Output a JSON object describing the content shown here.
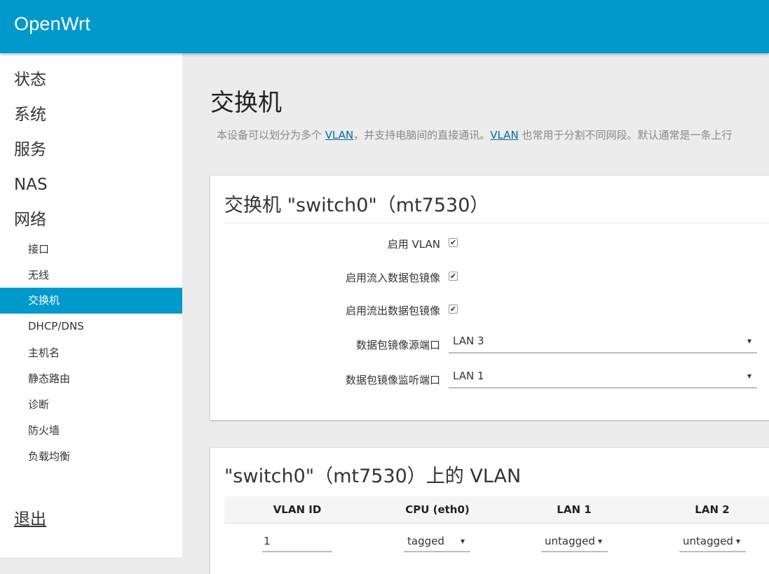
{
  "app": {
    "brand": "OpenWrt"
  },
  "sidebar": {
    "top_items": [
      {
        "label": "状态"
      },
      {
        "label": "系统"
      },
      {
        "label": "服务"
      },
      {
        "label": "NAS"
      },
      {
        "label": "网络"
      }
    ],
    "network_items": [
      {
        "label": "接口"
      },
      {
        "label": "无线"
      },
      {
        "label": "交换机"
      },
      {
        "label": "DHCP/DNS"
      },
      {
        "label": "主机名"
      },
      {
        "label": "静态路由"
      },
      {
        "label": "诊断"
      },
      {
        "label": "防火墙"
      },
      {
        "label": "负载均衡"
      }
    ],
    "active_item": "交换机",
    "logout": "退出"
  },
  "page": {
    "title": "交换机",
    "desc_1": "本设备可以划分为多个 ",
    "desc_link_1": "VLAN",
    "desc_2": "，并支持电脑间的直接通讯。",
    "desc_link_2": "VLAN",
    "desc_3": " 也常用于分割不同网段。默认通常是一条上行"
  },
  "switch_section": {
    "title": "交换机 \"switch0\"（mt7530）",
    "enable_vlan_label": "启用 VLAN",
    "enable_vlan_checked": true,
    "mirror_rx_label": "启用流入数据包镜像",
    "mirror_rx_checked": true,
    "mirror_tx_label": "启用流出数据包镜像",
    "mirror_tx_checked": true,
    "mirror_source_label": "数据包镜像源端口",
    "mirror_source_value": "LAN 3",
    "mirror_monitor_label": "数据包镜像监听端口",
    "mirror_monitor_value": "LAN 1"
  },
  "vlan_section": {
    "title": "\"switch0\"（mt7530）上的 VLAN",
    "columns": [
      "VLAN ID",
      "CPU (eth0)",
      "LAN 1",
      "LAN 2"
    ],
    "rows": [
      {
        "vlan_id": "1",
        "cpu": "tagged",
        "lan1": "untagged",
        "lan2": "untagged"
      }
    ]
  },
  "icons": {
    "dropdown": "▾",
    "check": "✔"
  }
}
